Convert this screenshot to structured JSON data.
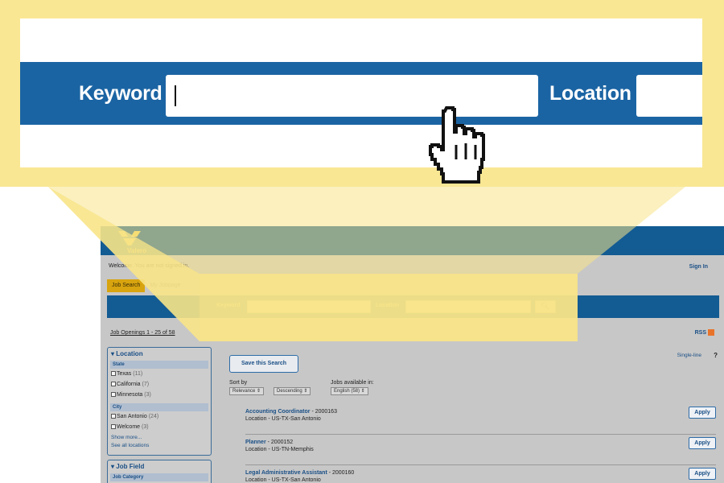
{
  "zoom": {
    "keyword_label": "Keyword",
    "location_label": "Location",
    "keyword_value": "",
    "location_value": ""
  },
  "site": {
    "logo_text": "Valero",
    "welcome": "Welcome. You are not signed in.",
    "sign_in": "Sign In",
    "tabs": [
      {
        "label": "Job Search",
        "active": true
      },
      {
        "label": "My Jobpage",
        "active": false
      }
    ],
    "search": {
      "keyword_label": "Keyword",
      "location_label": "Location",
      "search_icon": "magnifier-icon"
    },
    "openings": "Job Openings 1 - 25 of 58",
    "rss": "RSS",
    "sidebar": {
      "location_title": "Location",
      "state_header": "State",
      "states": [
        {
          "name": "Texas",
          "count": "(11)"
        },
        {
          "name": "California",
          "count": "(7)"
        },
        {
          "name": "Minnesota",
          "count": "(3)"
        }
      ],
      "city_header": "City",
      "cities": [
        {
          "name": "San Antonio",
          "count": "(24)"
        },
        {
          "name": "Welcome",
          "count": "(3)"
        }
      ],
      "show_more": "Show more...",
      "see_all": "See all locations",
      "job_field_title": "Job Field",
      "job_category": "Job Category"
    },
    "save_search": "Save this Search",
    "sort_by": "Sort by",
    "sort_options": [
      "Relevance",
      "Descending"
    ],
    "jobs_available": "Jobs available in:",
    "language": "English (58)",
    "single_line": "Single-line",
    "help": "?",
    "jobs": [
      {
        "title": "Accounting Coordinator",
        "id": " - 2000163",
        "location": "Location - US-TX-San Antonio",
        "apply": "Apply"
      },
      {
        "title": "Planner",
        "id": " - 2000152",
        "location": "Location - US-TN-Memphis",
        "apply": "Apply"
      },
      {
        "title": "Legal Administrative Assistant",
        "id": " - 2000160",
        "location": "Location - US-TX-San Antonio",
        "apply": "Apply"
      }
    ]
  },
  "colors": {
    "callout_yellow": "#f8e488",
    "zoom_bar_blue": "#1b64a3",
    "site_blue": "#135b93",
    "label_gold": "#ffe58a"
  }
}
